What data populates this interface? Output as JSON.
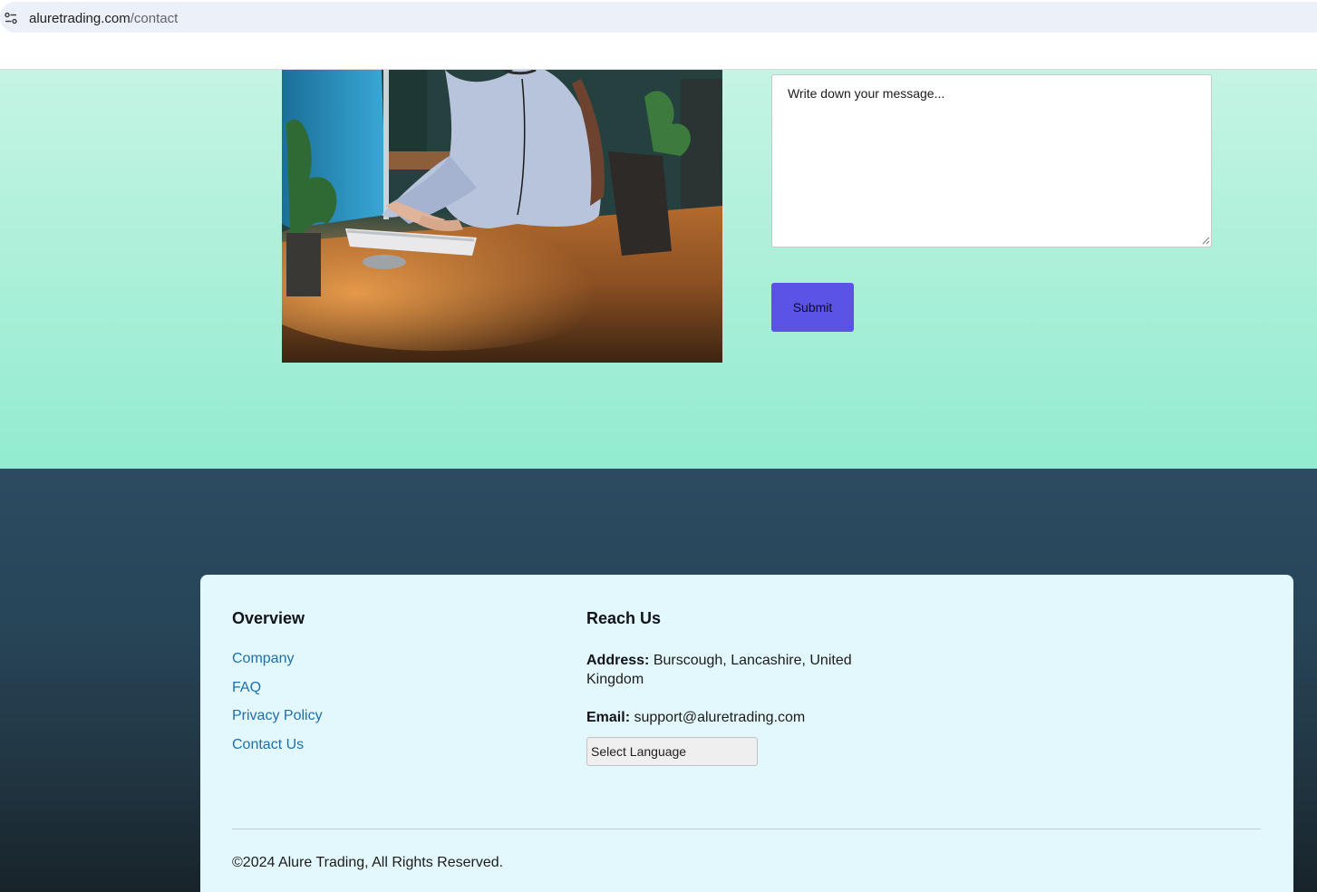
{
  "browser": {
    "url_domain": "aluretrading.com",
    "url_path": "/contact"
  },
  "contact_form": {
    "message_placeholder": "Write down your message...",
    "submit_label": "Submit"
  },
  "footer": {
    "overview": {
      "heading": "Overview",
      "links": [
        "Company",
        "FAQ",
        "Privacy Policy",
        "Contact Us"
      ]
    },
    "reach_us": {
      "heading": "Reach Us",
      "address_label": "Address:",
      "address_value": "Burscough, Lancashire, United Kingdom",
      "email_label": "Email:",
      "email_value": "support@aluretrading.com",
      "language_select": "Select Language"
    },
    "copyright": "©2024 Alure Trading, All Rights Reserved."
  },
  "colors": {
    "submit_button": "#5b53e6",
    "link": "#1f6fa8",
    "footer_card": "#e3f8fd"
  }
}
